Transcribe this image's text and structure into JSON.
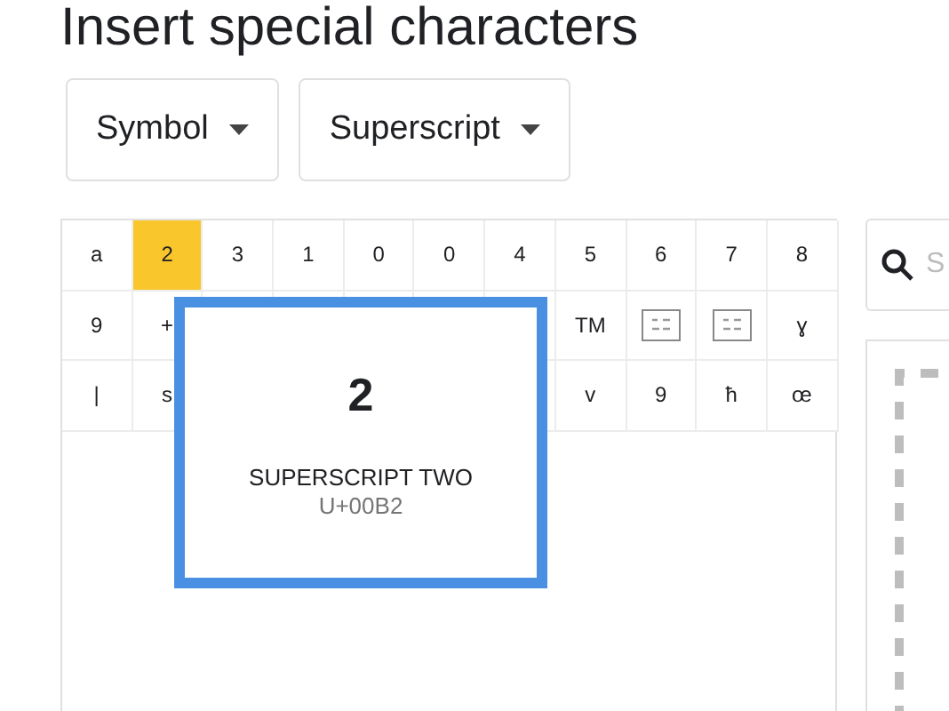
{
  "title": "Insert special characters",
  "dropdowns": [
    {
      "label": "Symbol"
    },
    {
      "label": "Superscript"
    }
  ],
  "grid": {
    "rows": [
      [
        {
          "kind": "glyph",
          "char": "a",
          "selected": false
        },
        {
          "kind": "glyph",
          "char": "2",
          "selected": true
        },
        {
          "kind": "glyph",
          "char": "3",
          "selected": false
        },
        {
          "kind": "glyph",
          "char": "1",
          "selected": false
        },
        {
          "kind": "glyph",
          "char": "0",
          "selected": false
        },
        {
          "kind": "glyph",
          "char": "0",
          "selected": false
        },
        {
          "kind": "glyph",
          "char": "4",
          "selected": false
        },
        {
          "kind": "glyph",
          "char": "5",
          "selected": false
        },
        {
          "kind": "glyph",
          "char": "6",
          "selected": false
        },
        {
          "kind": "glyph",
          "char": "7",
          "selected": false
        },
        {
          "kind": "glyph",
          "char": "8",
          "selected": false
        }
      ],
      [
        {
          "kind": "glyph",
          "char": "9",
          "selected": false
        },
        {
          "kind": "glyph",
          "char": "+",
          "selected": false
        },
        null,
        null,
        null,
        null,
        null,
        {
          "kind": "glyph",
          "char": "TM",
          "selected": false
        },
        {
          "kind": "missing",
          "selected": false
        },
        {
          "kind": "missing",
          "selected": false
        },
        {
          "kind": "glyph",
          "char": "ɣ",
          "selected": false
        }
      ],
      [
        {
          "kind": "glyph",
          "char": "|",
          "selected": false
        },
        {
          "kind": "glyph",
          "char": "s",
          "selected": false
        },
        null,
        null,
        null,
        null,
        null,
        {
          "kind": "glyph",
          "char": "v",
          "selected": false
        },
        {
          "kind": "glyph",
          "char": "9",
          "selected": false
        },
        {
          "kind": "glyph",
          "char": "ħ",
          "selected": false
        },
        {
          "kind": "glyph",
          "char": "œ",
          "selected": false
        }
      ]
    ]
  },
  "preview": {
    "char": "2",
    "name": "SUPERSCRIPT TWO",
    "code": "U+00B2"
  },
  "search": {
    "placeholder": "S"
  }
}
